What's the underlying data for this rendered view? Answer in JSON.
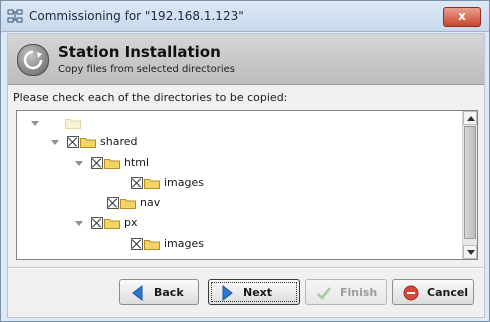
{
  "window": {
    "title": "Commissioning for \"192.168.1.123\"",
    "icon": "network-grid-icon",
    "close_label": "x"
  },
  "header": {
    "title": "Station Installation",
    "subtitle": "Copy files from selected directories",
    "icon": "wizard-arrow-icon"
  },
  "instruction": "Please check each of the directories to be copied:",
  "tree": {
    "nodes": [
      {
        "label": "",
        "depth": 0,
        "expanded": true,
        "checkbox": false,
        "checked": false
      },
      {
        "label": "shared",
        "depth": 1,
        "expanded": true,
        "checkbox": true,
        "checked": true
      },
      {
        "label": "html",
        "depth": 2,
        "expanded": true,
        "checkbox": true,
        "checked": true
      },
      {
        "label": "images",
        "depth": 3,
        "expanded": false,
        "checkbox": true,
        "checked": true
      },
      {
        "label": "nav",
        "depth": 2,
        "expanded": false,
        "checkbox": true,
        "checked": true
      },
      {
        "label": "px",
        "depth": 2,
        "expanded": true,
        "checkbox": true,
        "checked": true
      },
      {
        "label": "images",
        "depth": 3,
        "expanded": false,
        "checkbox": true,
        "checked": true
      }
    ]
  },
  "buttons": {
    "back": {
      "label": "Back",
      "icon": "back-arrow-icon",
      "enabled": true
    },
    "next": {
      "label": "Next",
      "icon": "next-arrow-icon",
      "enabled": true
    },
    "finish": {
      "label": "Finish",
      "icon": "checkmark-icon",
      "enabled": false
    },
    "cancel": {
      "label": "Cancel",
      "icon": "cancel-icon",
      "enabled": true
    }
  },
  "colors": {
    "accent_blue": "#2a78d4",
    "cancel_red": "#d9463a",
    "folder_yellow": "#f5d36b"
  }
}
